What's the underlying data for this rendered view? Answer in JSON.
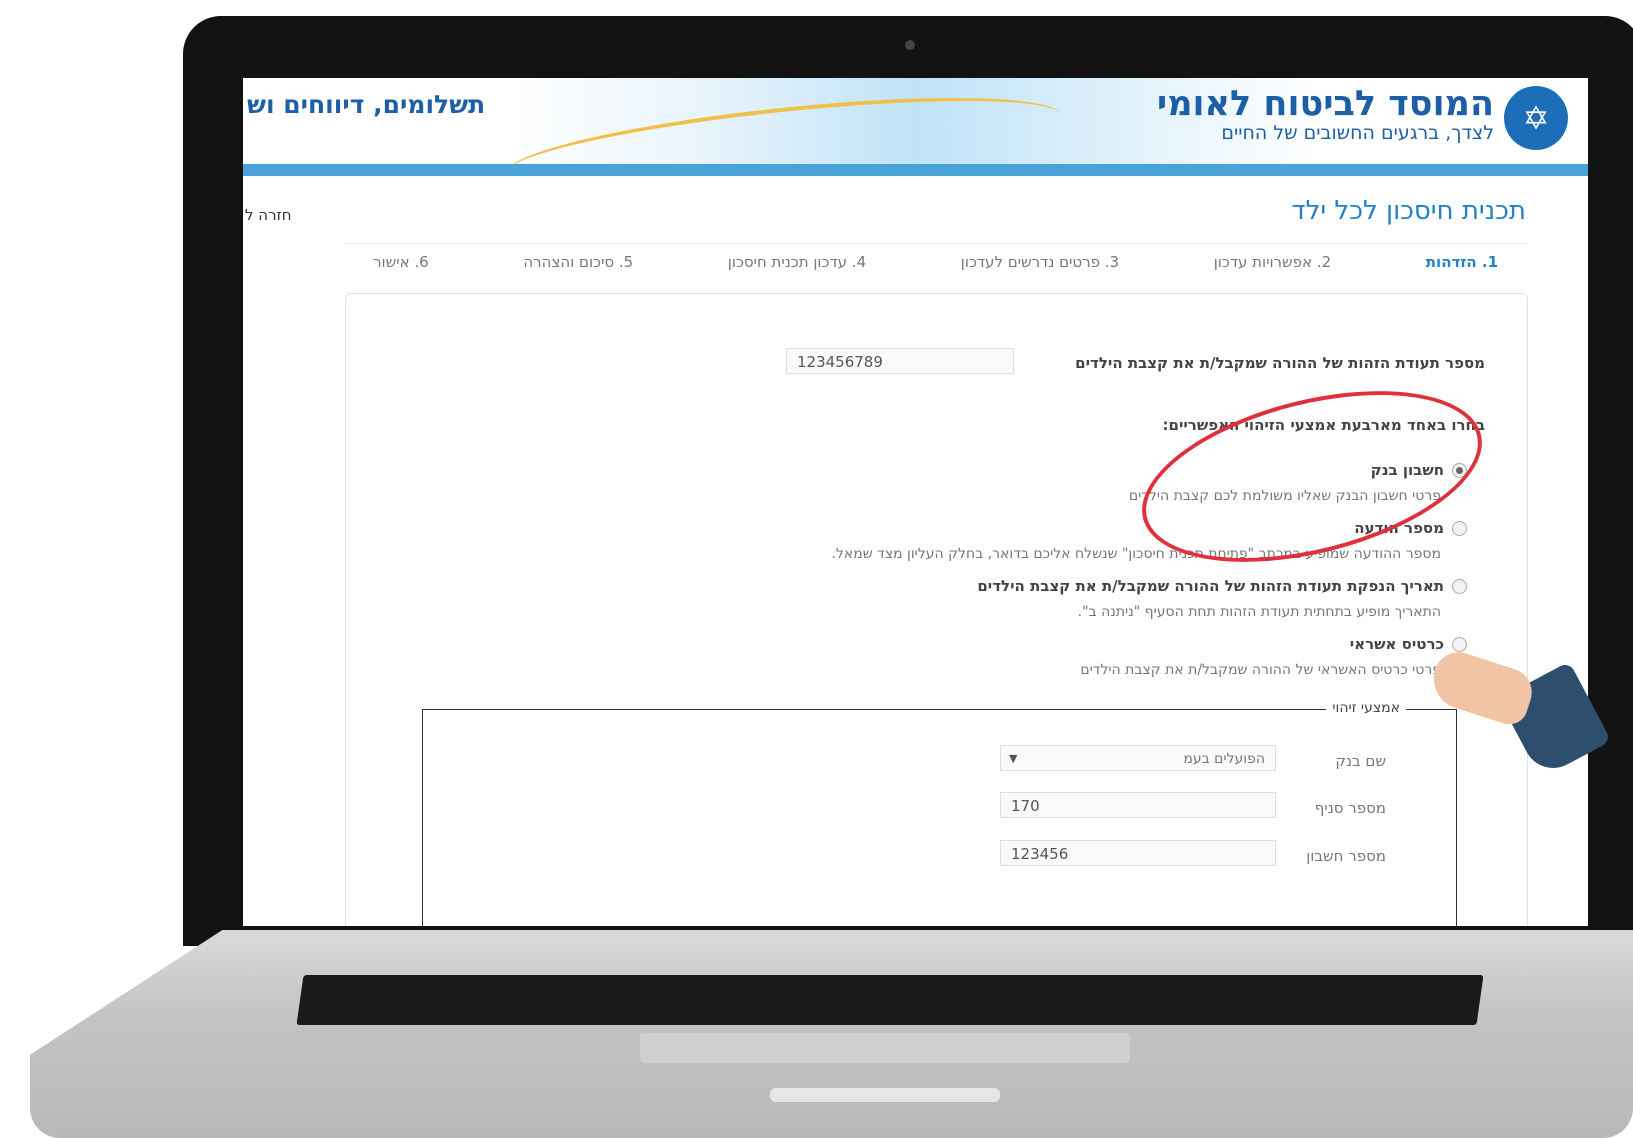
{
  "header": {
    "institution_name": "המוסד לביטוח לאומי",
    "slogan": "לצדך, ברגעים החשובים של החיים",
    "section": "תשלומים, דיווחים וש"
  },
  "page": {
    "title": "תכנית חיסכון לכל ילד",
    "back_link": "חזרה ל"
  },
  "steps": [
    {
      "label": "1. הזדהות",
      "active": true
    },
    {
      "label": "2. אפשרויות עדכון",
      "active": false
    },
    {
      "label": "3. פרטים נדרשים לעדכון",
      "active": false
    },
    {
      "label": "4. עדכון תכנית חיסכון",
      "active": false
    },
    {
      "label": "5. סיכום והצהרה",
      "active": false
    },
    {
      "label": "6. אישור",
      "active": false
    }
  ],
  "form": {
    "id_label": "מספר תעודת הזהות של ההורה שמקבל/ת את קצבת הילדים",
    "id_value": "123456789",
    "choose_label": "בחרו באחד מארבעת אמצעי הזיהוי האפשריים:",
    "options": [
      {
        "label": "חשבון בנק",
        "hint": "פרטי חשבון הבנק שאליו משולמת לכם קצבת הילדים",
        "selected": true
      },
      {
        "label": "מספר הודעה",
        "hint": "מספר ההודעה שמופיע במכתב \"פתיחת תכנית חיסכון\" שנשלח אליכם בדואר, בחלק העליון מצד שמאל.",
        "selected": false
      },
      {
        "label": "תאריך הנפקת תעודת הזהות של ההורה שמקבל/ת את קצבת הילדים",
        "hint": "התאריך מופיע בתחתית תעודת הזהות תחת הסעיף \"ניתנה ב\".",
        "selected": false
      },
      {
        "label": "כרטיס אשראי",
        "hint": "פרטי כרטיס האשראי של ההורה שמקבל/ת את קצבת הילדים",
        "selected": false
      }
    ],
    "fieldset_legend": "אמצעי זיהוי",
    "bank_name_label": "שם בנק",
    "bank_name_value": "הפועלים בעמ",
    "branch_label": "מספר סניף",
    "branch_value": "170",
    "account_label": "מספר חשבון",
    "account_value": "123456"
  },
  "colors": {
    "brand": "#1c5fa6",
    "accent": "#2183c6",
    "highlight": "#e0313a"
  }
}
